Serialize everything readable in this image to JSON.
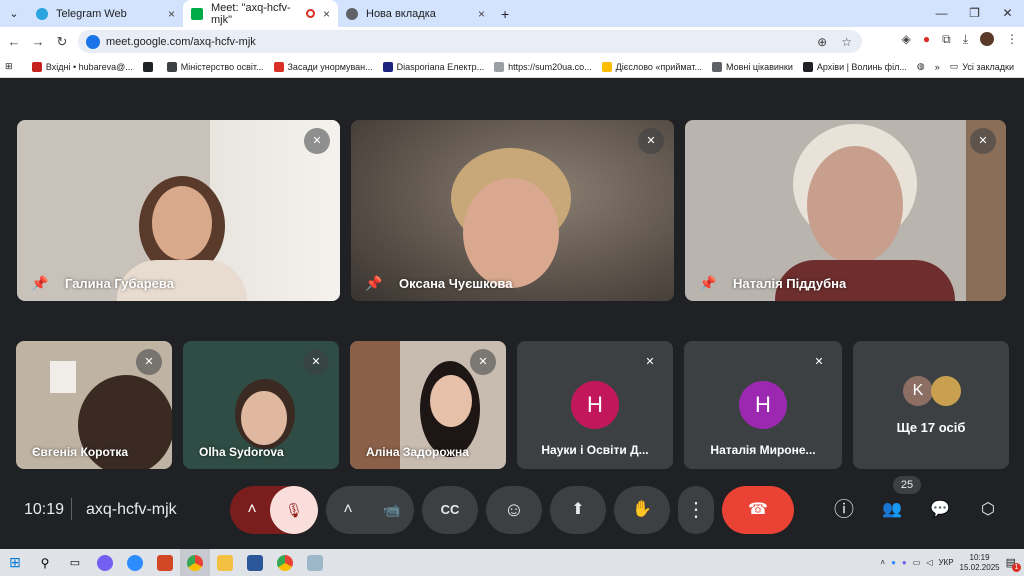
{
  "tabs": [
    {
      "title": "Telegram Web",
      "close": "×",
      "color": "#2aa3df"
    },
    {
      "title": "Meet: \"axq-hcfv-mjk\"",
      "close": "×",
      "color": "#00ac47"
    },
    {
      "title": "Нова вкладка",
      "close": "×",
      "color": "#5f6368"
    }
  ],
  "new_tab": "+",
  "window": {
    "minimize": "—",
    "restore": "❐",
    "close": "✕"
  },
  "toolbar": {
    "back": "←",
    "forward": "→",
    "reload": "↻",
    "url": "meet.google.com/axq-hcfv-mjk",
    "zoom": "⊕",
    "star": "☆"
  },
  "bookmarks": [
    {
      "label": "Вхідні • hubareva@...",
      "color": "#c5221f"
    },
    {
      "label": "",
      "color": "#202124"
    },
    {
      "label": "Міністерство освіт...",
      "color": "#3c4043"
    },
    {
      "label": "Засади унормуван...",
      "color": "#d93025"
    },
    {
      "label": "Diasporiana Електр...",
      "color": "#1a237e"
    },
    {
      "label": "https://sum20ua.co...",
      "color": "#9aa0a6"
    },
    {
      "label": "Дієслово «приймат...",
      "color": "#fbbc04"
    },
    {
      "label": "Мовні цікавинки",
      "color": "#5f6368"
    },
    {
      "label": "Архіви | Волинь філ...",
      "color": "#202124"
    }
  ],
  "bookmarks_more": "»",
  "bookmarks_all": "Усі закладки",
  "participants_top": [
    {
      "name": "Галина Губарева",
      "bg": "#c9c2bb",
      "skin": "#d9a98c",
      "hair": "#5a3a2a"
    },
    {
      "name": "Оксана Чуєшкова",
      "bg": "#5a5048",
      "skin": "#d9a88e",
      "hair": "#c8a878"
    },
    {
      "name": "Наталія Піддубна",
      "bg": "#b9b4ae",
      "skin": "#c79f8c",
      "hair": "#e8e2d8"
    }
  ],
  "participants_bottom": [
    {
      "name": "Євгенія Коротка",
      "type": "video",
      "bg": "#bfb3a4"
    },
    {
      "name": "Olha Sydorova",
      "type": "video",
      "bg": "#2f4d44"
    },
    {
      "name": "Аліна Задорожна",
      "type": "video",
      "bg": "#c8bcb0"
    },
    {
      "name": "Науки і Освіти Д...",
      "type": "avatar",
      "letter": "Н",
      "avatar_color": "#c2185b",
      "bg": "#3c4043"
    },
    {
      "name": "Наталія Мироне...",
      "type": "avatar",
      "letter": "Н",
      "avatar_color": "#9c27b0",
      "bg": "#3c4043"
    }
  ],
  "more_tile": {
    "letter": "K",
    "label": "Ще 17 осіб"
  },
  "controls": {
    "time": "10:19",
    "code": "axq-hcfv-mjk",
    "participants_count": "25",
    "icons": {
      "arrow_up": "˄",
      "mic_off": "🎙",
      "camera": "📹",
      "captions": "CC",
      "emoji": "☺",
      "present": "⬆",
      "raise_hand": "✋",
      "more": "⋮",
      "leave": "☎",
      "info": "ⓘ",
      "people": "👥",
      "chat": "💬",
      "activities": "⬡"
    }
  },
  "tray": {
    "lang": "УКР",
    "time": "10:19",
    "date": "15.02.2025",
    "notif": "1"
  }
}
